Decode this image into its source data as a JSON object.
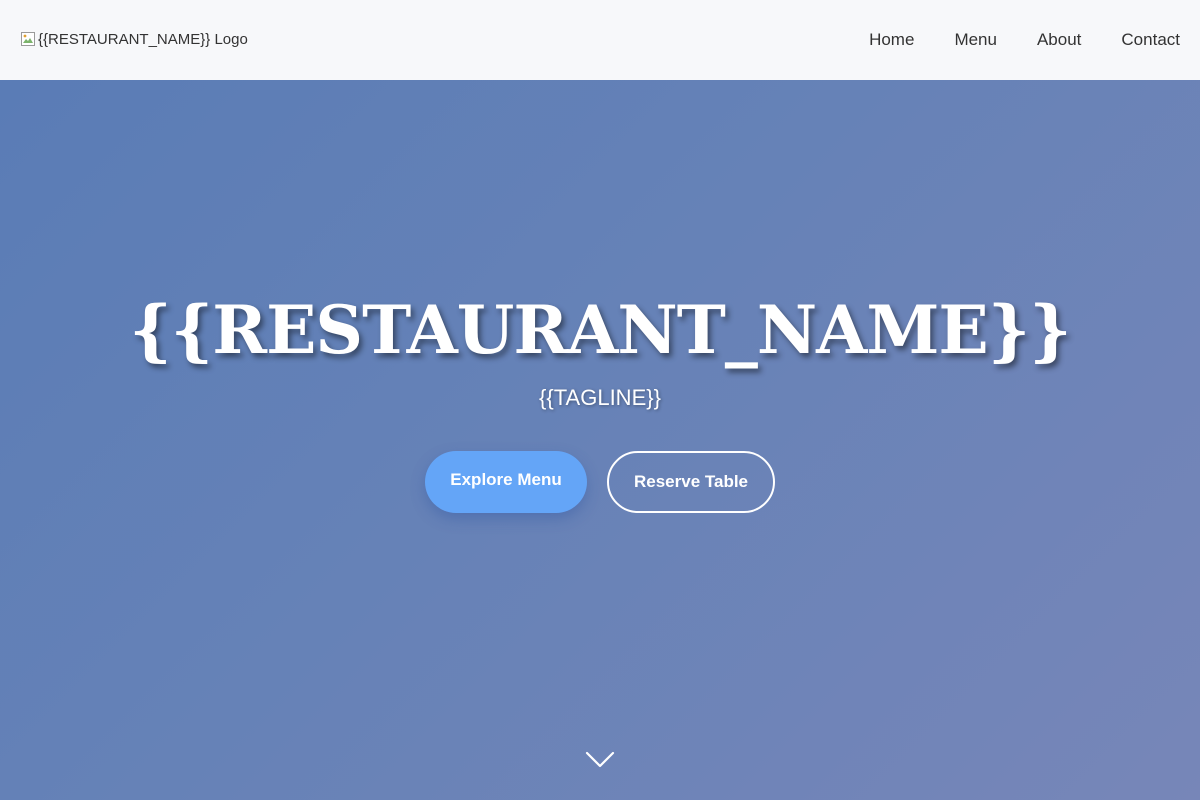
{
  "header": {
    "logo_alt": "{{RESTAURANT_NAME}} Logo",
    "nav": [
      {
        "label": "Home"
      },
      {
        "label": "Menu"
      },
      {
        "label": "About"
      },
      {
        "label": "Contact"
      }
    ]
  },
  "hero": {
    "title": "{{RESTAURANT_NAME}}",
    "tagline": "{{TAGLINE}}",
    "primary_button": "Explore Menu",
    "secondary_button": "Reserve Table",
    "scroll_icon": "chevron-down-icon"
  },
  "colors": {
    "header_bg": "#f7f8fa",
    "hero_gradient_start": "#5a7cb6",
    "hero_gradient_end": "#7786b8",
    "primary_button": "#64a5f7",
    "text_light": "#ffffff",
    "nav_text": "#333333"
  }
}
